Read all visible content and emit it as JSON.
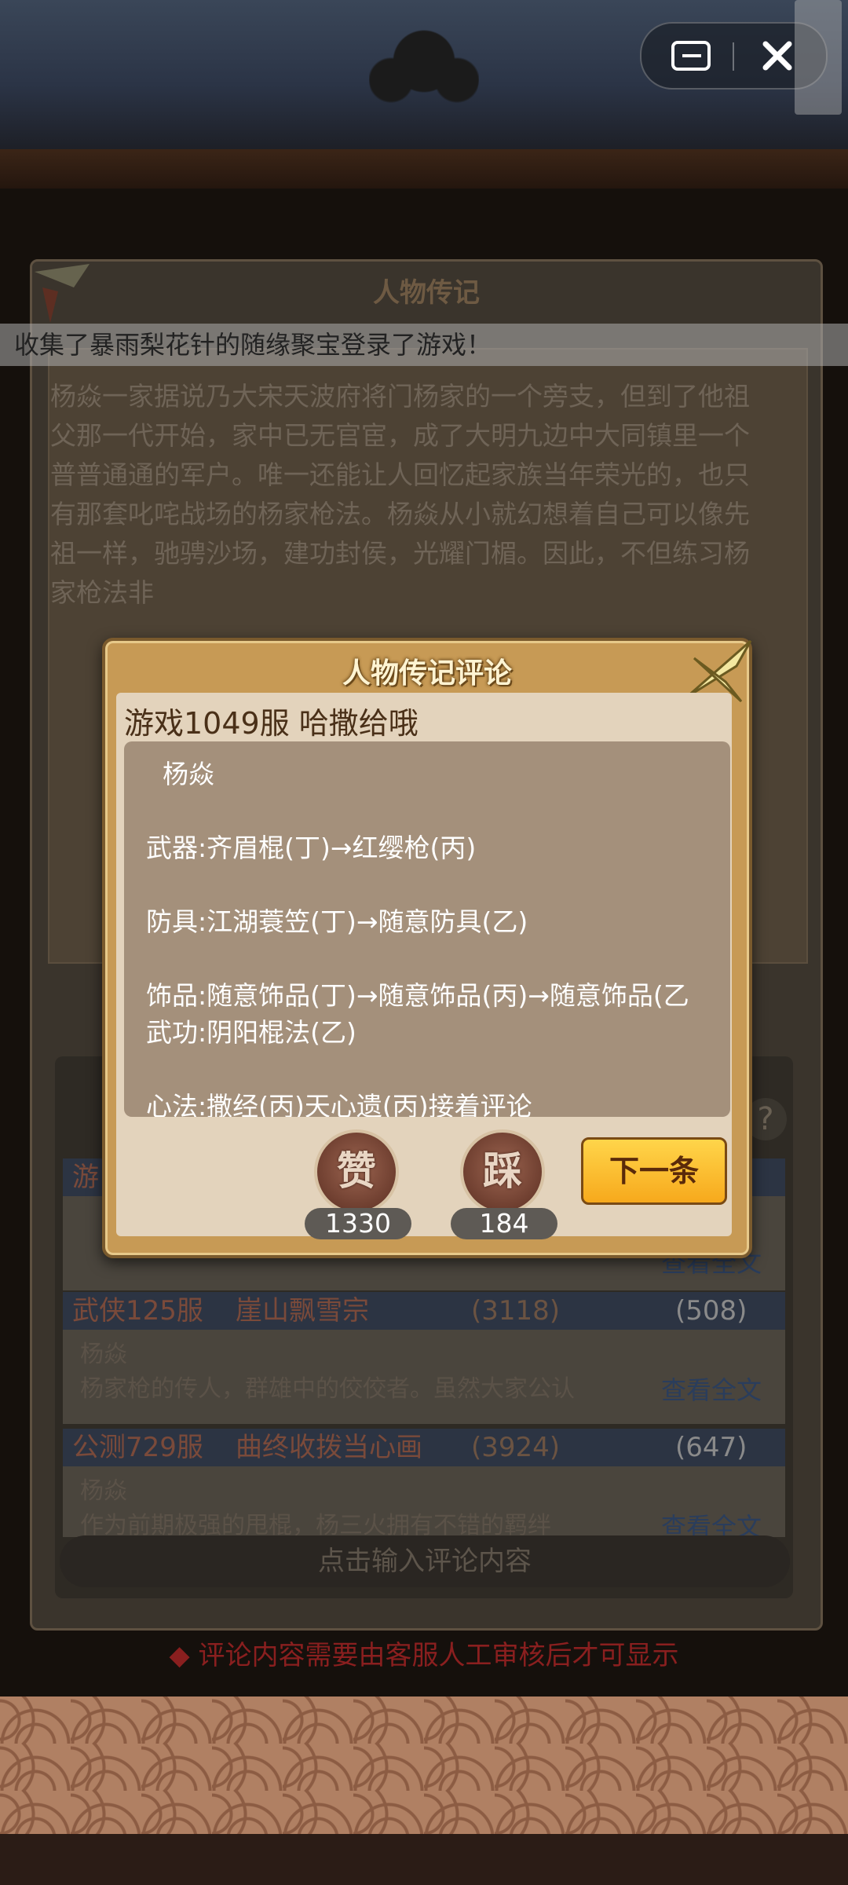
{
  "window_controls": {
    "menu_icon": "menu-icon",
    "close_icon": "close-icon"
  },
  "announcement": "收集了暴雨梨花针的随缘聚宝登录了游戏！",
  "bio_panel": {
    "title": "人物传记",
    "text": "杨焱一家据说乃大宋天波府将门杨家的一个旁支，但到了他祖父那一代开始，家中已无官宦，成了大明九边中大同镇里一个普普通通的军户。唯一还能让人回忆起家族当年荣光的，也只有那套叱咤战场的杨家枪法。杨焱从小就幻想着自己可以像先祖一样，驰骋沙场，建功封侯，光耀门楣。因此，不但练习杨家枪法非"
  },
  "comments": [
    {
      "server": "游",
      "likes": "",
      "dislikes": "",
      "name": "",
      "text": "",
      "link": "查看全文"
    },
    {
      "server": "武侠125服",
      "player": "崖山飘雪宗",
      "likes": "(3118)",
      "dislikes": "(508)",
      "name": "杨焱",
      "text": "杨家枪的传人，群雄中的佼佼者。虽然大家公认",
      "link": "查看全文"
    },
    {
      "server": "公测729服",
      "player": "曲终收拨当心画",
      "likes": "(3924)",
      "dislikes": "(647)",
      "name": "杨焱",
      "text": "作为前期极强的甩棍，杨三火拥有不错的羁绊",
      "link": "查看全文"
    }
  ],
  "input_placeholder": "点击输入评论内容",
  "notice": "◆ 评论内容需要由客服人工审核后才可显示",
  "dialog": {
    "title": "人物传记评论",
    "author": "游戏1049服 哈撒给哦",
    "content": "  杨焱\n\n武器:齐眉棍(丁)→红缨枪(丙)\n\n防具:江湖蓑笠(丁)→随意防具(乙)\n\n饰品:随意饰品(丁)→随意饰品(丙)→随意饰品(乙武功:阴阳棍法(乙)\n\n心法:撒经(丙)天心遗(丙)接着评论",
    "like_label": "赞",
    "like_count": "1330",
    "dislike_label": "踩",
    "dislike_count": "184",
    "next_label": "下一条"
  },
  "colors": {
    "dialog_frame": "#c79a55",
    "next_button": "#f7a91c",
    "content_box": "#a4907b"
  }
}
